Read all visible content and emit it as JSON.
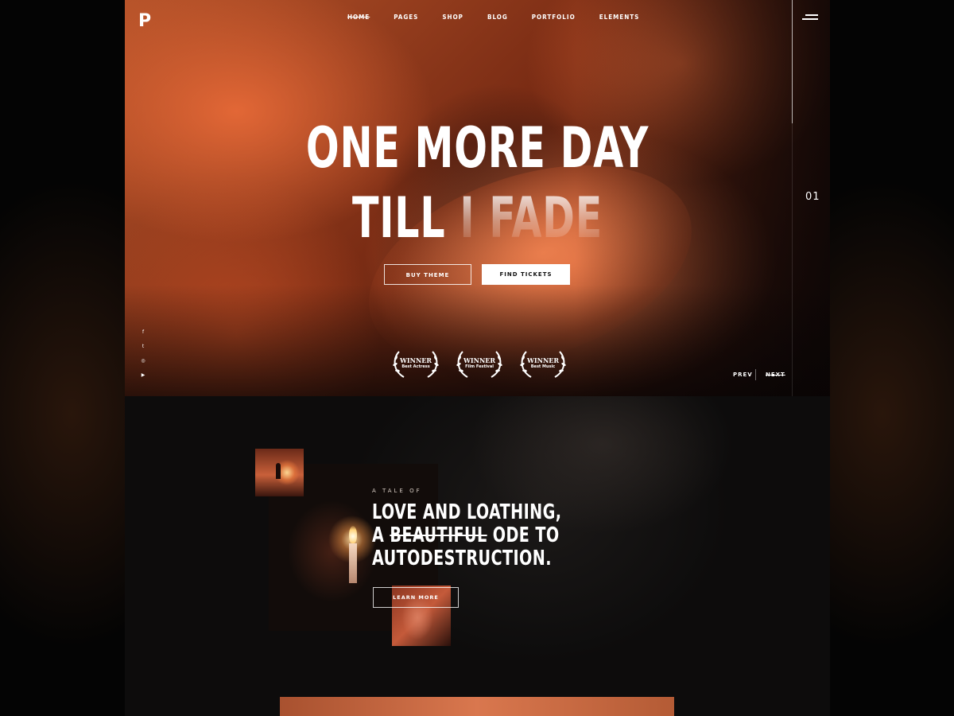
{
  "brand": {
    "logo": "P"
  },
  "nav": {
    "items": [
      "HOME",
      "PAGES",
      "SHOP",
      "BLOG",
      "PORTFOLIO",
      "ELEMENTS"
    ],
    "active": "HOME"
  },
  "hero": {
    "headline_line1": "ONE MORE DAY",
    "headline_line2_a": "TILL",
    "headline_line2_b": "I FADE",
    "slide_number": "01",
    "buy_label": "BUY THEME",
    "tickets_label": "FIND TICKETS",
    "awards": [
      {
        "title": "WINNER",
        "subtitle": "Best Actress"
      },
      {
        "title": "WINNER",
        "subtitle": "Film Festival"
      },
      {
        "title": "WINNER",
        "subtitle": "Best Music"
      }
    ],
    "social_icons": [
      "facebook-icon",
      "twitter-icon",
      "instagram-icon",
      "youtube-icon"
    ],
    "prev_label": "PREV",
    "next_label": "NEXT"
  },
  "story": {
    "eyebrow": "A TALE OF",
    "line1": "LOVE AND LOATHING,",
    "line2_a": "A",
    "line2_strike": "BEAUTIFUL",
    "line2_b": "ODE TO",
    "line3": "AUTODESTRUCTION.",
    "button_label": "LEARN MORE"
  },
  "colors": {
    "accent": "#d9774e",
    "hero_tone": "#b8542a",
    "background": "#0b0a0a"
  }
}
